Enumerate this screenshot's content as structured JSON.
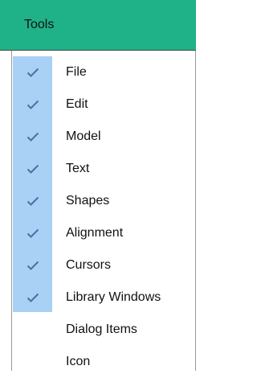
{
  "header": {
    "title": "Tools"
  },
  "menu": {
    "items": [
      {
        "label": "File",
        "checked": true
      },
      {
        "label": "Edit",
        "checked": true
      },
      {
        "label": "Model",
        "checked": true
      },
      {
        "label": "Text",
        "checked": true
      },
      {
        "label": "Shapes",
        "checked": true
      },
      {
        "label": "Alignment",
        "checked": true
      },
      {
        "label": "Cursors",
        "checked": true
      },
      {
        "label": "Library Windows",
        "checked": true
      },
      {
        "label": "Dialog Items",
        "checked": false
      },
      {
        "label": "Icon",
        "checked": false
      }
    ]
  },
  "colors": {
    "header_bg": "#1fb188",
    "check_column_bg": "#a9d0f5",
    "check_color": "#4a6fa5"
  },
  "icons": {
    "check": "checkmark-icon"
  }
}
